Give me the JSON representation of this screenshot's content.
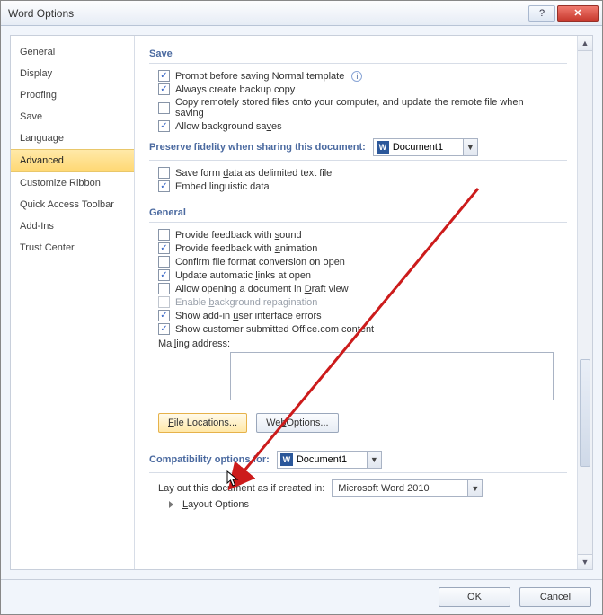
{
  "window": {
    "title": "Word Options"
  },
  "sidebar": {
    "items": [
      {
        "label": "General"
      },
      {
        "label": "Display"
      },
      {
        "label": "Proofing"
      },
      {
        "label": "Save"
      },
      {
        "label": "Language"
      },
      {
        "label": "Advanced",
        "selected": true
      },
      {
        "label": "Customize Ribbon"
      },
      {
        "label": "Quick Access Toolbar"
      },
      {
        "label": "Add-Ins"
      },
      {
        "label": "Trust Center"
      }
    ]
  },
  "save_section": {
    "heading": "Save",
    "opt_prompt": "Prompt before saving Normal template",
    "opt_backup": "Always create backup copy",
    "opt_remote": "Copy remotely stored files onto your computer, and update the remote file when saving",
    "opt_bgsave_pre": "Allow background sa",
    "opt_bgsave_u": "v",
    "opt_bgsave_post": "es"
  },
  "preserve": {
    "heading": "Preserve fidelity when sharing this document:",
    "doc": "Document1",
    "opt_saveform_pre": "Save form ",
    "opt_saveform_u": "d",
    "opt_saveform_post": "ata as delimited text file",
    "opt_embed": "Embed linguistic data"
  },
  "general": {
    "heading": "General",
    "opt_sound_pre": "Provide feedback with ",
    "opt_sound_u": "s",
    "opt_sound_post": "ound",
    "opt_anim_pre": "Provide feedback with ",
    "opt_anim_u": "a",
    "opt_anim_post": "nimation",
    "opt_confirm": "Confirm file format conversion on open",
    "opt_update_pre": "Update automatic ",
    "opt_update_u": "l",
    "opt_update_post": "inks at open",
    "opt_draft_pre": "Allow opening a document in ",
    "opt_draft_u": "D",
    "opt_draft_post": "raft view",
    "opt_repag_pre": "Enable ",
    "opt_repag_u": "b",
    "opt_repag_post": "ackground repagination",
    "opt_addin_pre": "Show add-in ",
    "opt_addin_u": "u",
    "opt_addin_post": "ser interface errors",
    "opt_custcontent": "Show customer submitted Office.com content",
    "mailing_pre": "Mai",
    "mailing_u": "l",
    "mailing_post": "ing address:",
    "btn_file_pre": "",
    "btn_file_u": "F",
    "btn_file_post": "ile Locations...",
    "btn_web_pre": "We",
    "btn_web_u": "b",
    "btn_web_post": " Options..."
  },
  "compat": {
    "heading": "Compatibility options for:",
    "doc": "Document1",
    "layout_label": "Lay out this document as if created in:",
    "layout_combo": "Microsoft Word 2010",
    "layout_tree_pre": "",
    "layout_tree_u": "L",
    "layout_tree_post": "ayout Options"
  },
  "buttons": {
    "ok": "OK",
    "cancel": "Cancel"
  }
}
